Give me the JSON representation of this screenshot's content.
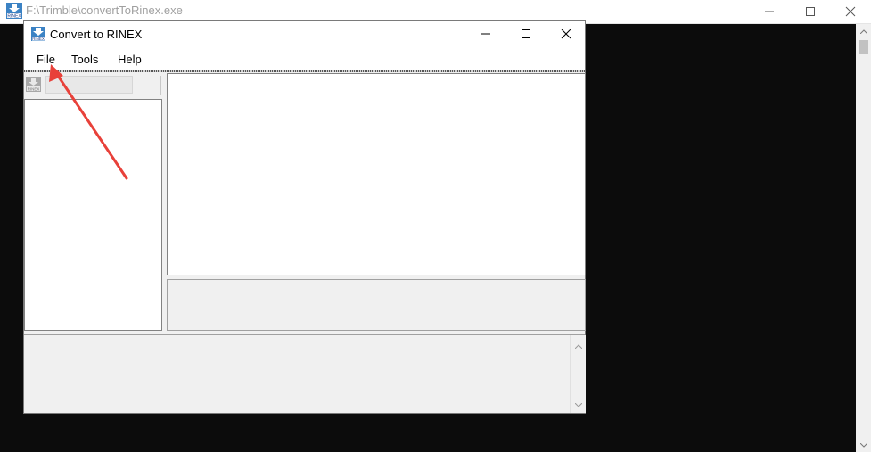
{
  "console": {
    "title": "F:\\Trimble\\convertToRinex.exe",
    "icon": "rinex-icon",
    "controls": [
      "minimize",
      "maximize",
      "close"
    ]
  },
  "app": {
    "title": "Convert to RINEX",
    "icon": "rinex-icon",
    "icon_label": "RINEX",
    "menu": [
      {
        "label": "File"
      },
      {
        "label": "Tools"
      },
      {
        "label": "Help"
      }
    ]
  },
  "colors": {
    "annotation_arrow": "#e8413a",
    "console_background": "#0c0c0c",
    "window_background": "#f0f0f0"
  }
}
